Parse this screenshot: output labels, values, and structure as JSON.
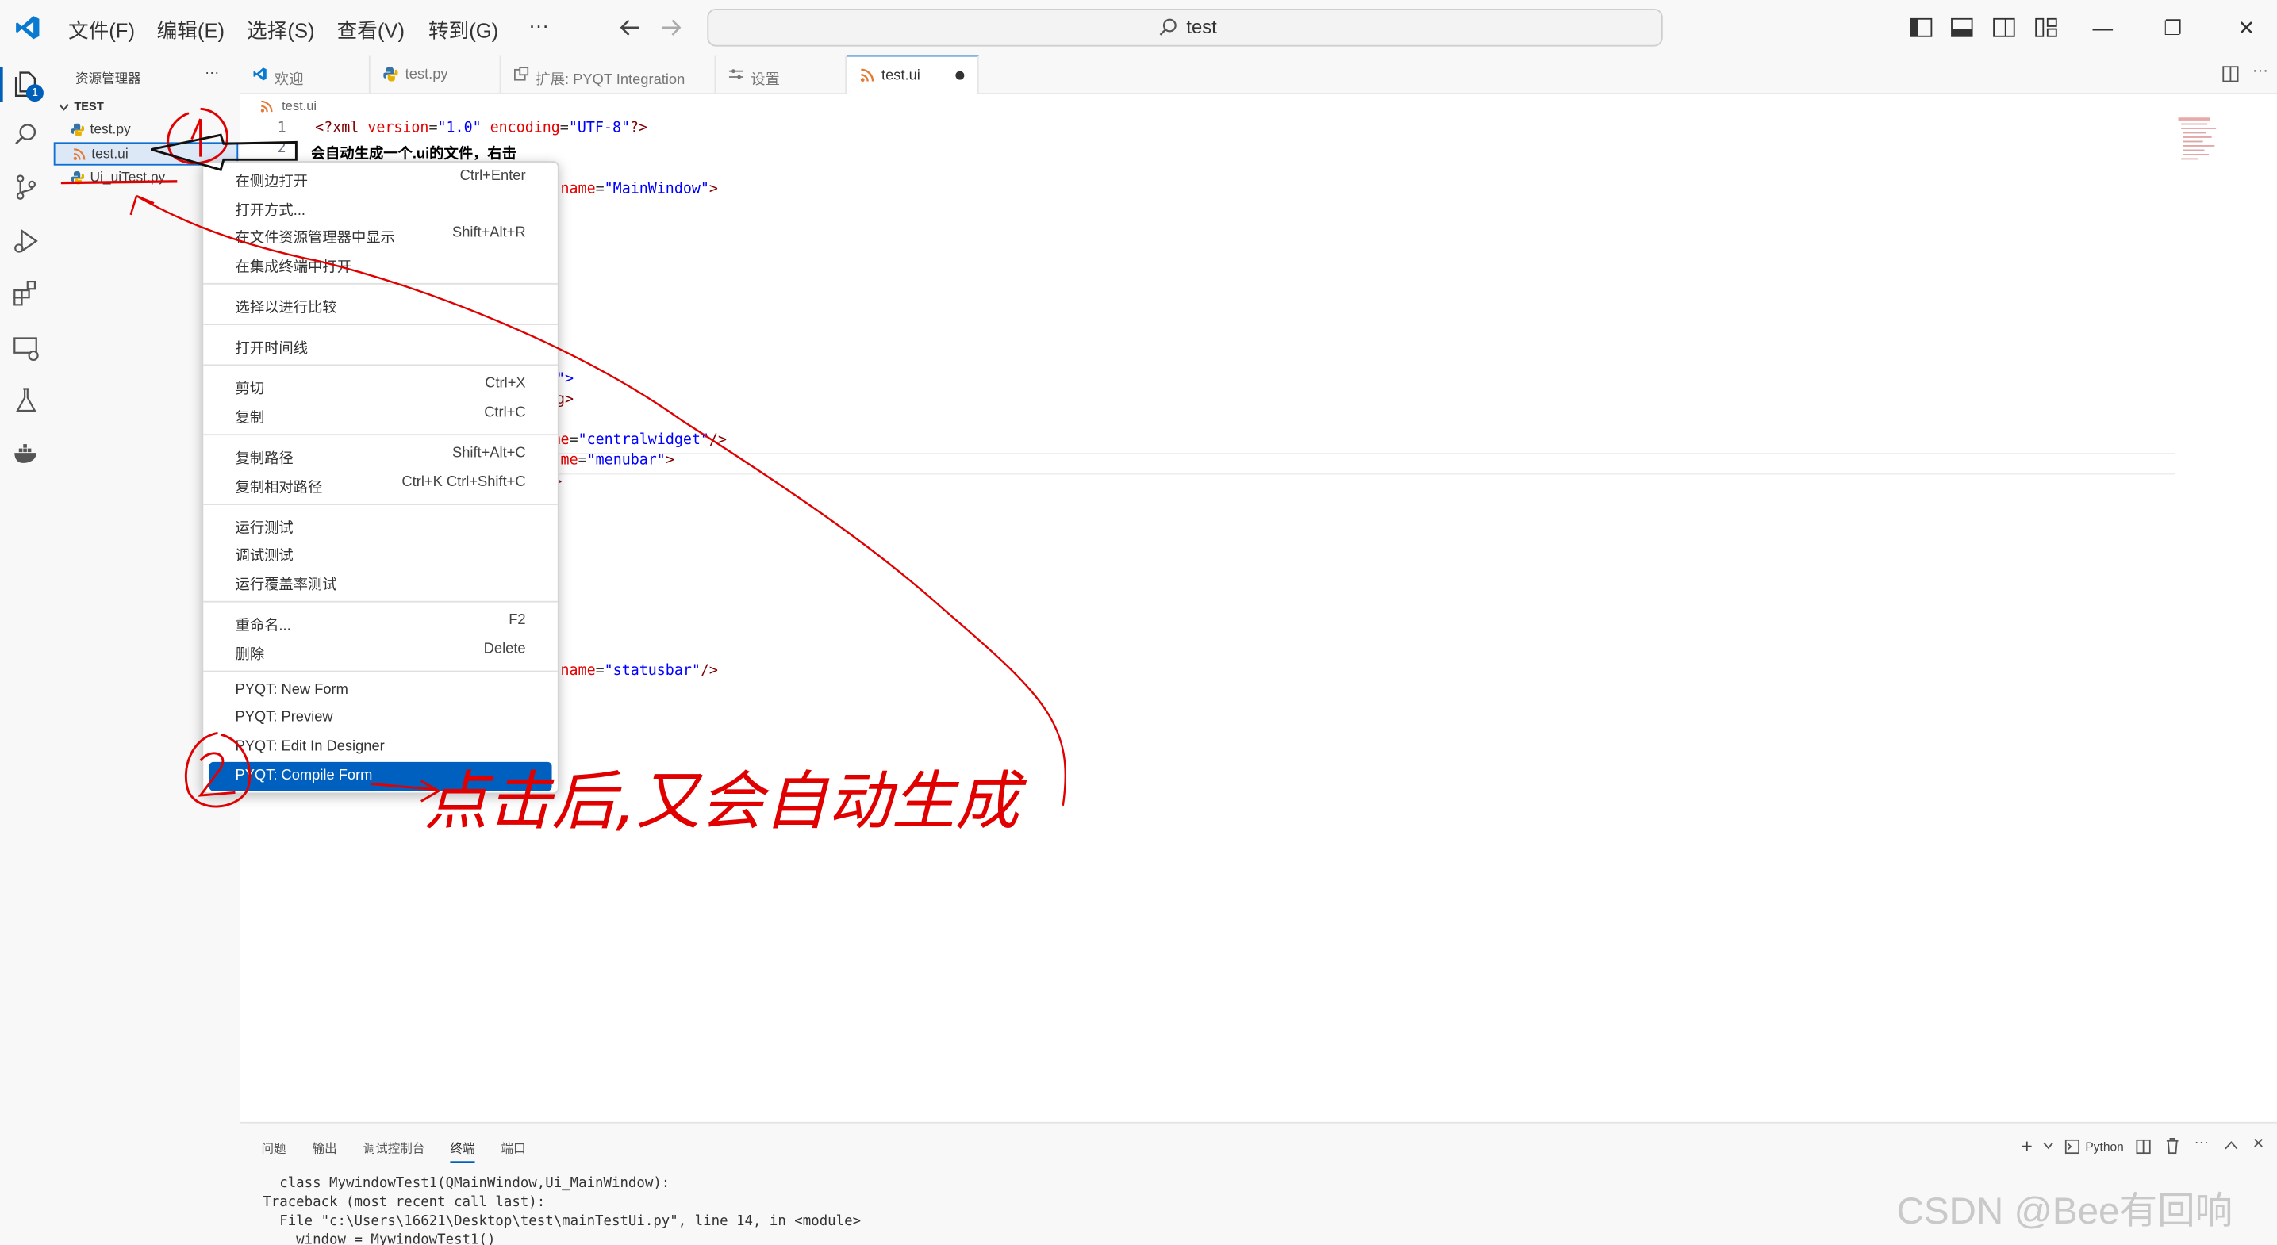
{
  "titlebar": {
    "menus": [
      "文件(F)",
      "编辑(E)",
      "选择(S)",
      "查看(V)",
      "转到(G)"
    ],
    "more": "···",
    "search_text": "test",
    "win_buttons": [
      "—",
      "❐",
      "✕"
    ]
  },
  "activity": {
    "badge": "1"
  },
  "sidebar": {
    "title": "资源管理器",
    "more": "···",
    "folder": "TEST",
    "files": [
      "test.py",
      "test.ui",
      "Ui_uiTest.py"
    ]
  },
  "tabs": [
    "欢迎",
    "test.py",
    "扩展: PYQT Integration",
    "设置",
    "test.ui"
  ],
  "editor": {
    "breadcrumb": "test.ui",
    "line1": {
      "num": "1",
      "pi_open": "<?xml ",
      "a1": "version",
      "v1": "\"1.0\"",
      "a2": " encoding",
      "v2": "\"UTF-8\"",
      "pi_close": "?>"
    },
    "line2_num": "2",
    "annotation_text": "会自动生成一个.ui的文件，右击",
    "frag_mainwindow": {
      "attr": "name",
      "val": "\"MainWindow\"",
      "end": ">"
    },
    "frag_a": "\">",
    "frag_b": "g>",
    "frag_central": {
      "attr": "me",
      "val": "\"centralwidget\"",
      "end": "/>"
    },
    "frag_menubar": {
      "attr": "ame",
      "val": "\"menubar\"",
      "end": ">"
    },
    "frag_c": ">",
    "frag_statusbar": {
      "attr": "name",
      "val": "\"statusbar\"",
      "end": "/>"
    }
  },
  "context_menu": [
    {
      "label": "在侧边打开",
      "key": "Ctrl+Enter"
    },
    {
      "label": "打开方式...",
      "key": ""
    },
    {
      "label": "在文件资源管理器中显示",
      "key": "Shift+Alt+R"
    },
    {
      "label": "在集成终端中打开",
      "key": ""
    },
    {
      "label": "选择以进行比较",
      "key": ""
    },
    {
      "label": "打开时间线",
      "key": ""
    },
    {
      "label": "剪切",
      "key": "Ctrl+X"
    },
    {
      "label": "复制",
      "key": "Ctrl+C"
    },
    {
      "label": "复制路径",
      "key": "Shift+Alt+C"
    },
    {
      "label": "复制相对路径",
      "key": "Ctrl+K Ctrl+Shift+C"
    },
    {
      "label": "运行测试",
      "key": ""
    },
    {
      "label": "调试测试",
      "key": ""
    },
    {
      "label": "运行覆盖率测试",
      "key": ""
    },
    {
      "label": "重命名...",
      "key": "F2"
    },
    {
      "label": "删除",
      "key": "Delete"
    },
    {
      "label": "PYQT: New Form",
      "key": ""
    },
    {
      "label": "PYQT: Preview",
      "key": ""
    },
    {
      "label": "PYQT: Edit In Designer",
      "key": ""
    },
    {
      "label": "PYQT: Compile Form",
      "key": ""
    }
  ],
  "panel": {
    "tabs": [
      "问题",
      "输出",
      "调试控制台",
      "终端",
      "端口"
    ],
    "shell": "Python",
    "terminal_lines": [
      "  class MywindowTest1(QMainWindow,Ui_MainWindow):",
      "Traceback (most recent call last):",
      "  File \"c:\\Users\\16621\\Desktop\\test\\mainTestUi.py\", line 14, in <module>",
      "    window = MywindowTest1()"
    ]
  },
  "annotations": {
    "handwritten_text": "点击后,又会自动生成"
  },
  "watermark": "CSDN @Bee有回响",
  "colors": {
    "accent": "#005fb8",
    "menu_highlight": "#0060c0",
    "annotation_red": "#e00000"
  }
}
